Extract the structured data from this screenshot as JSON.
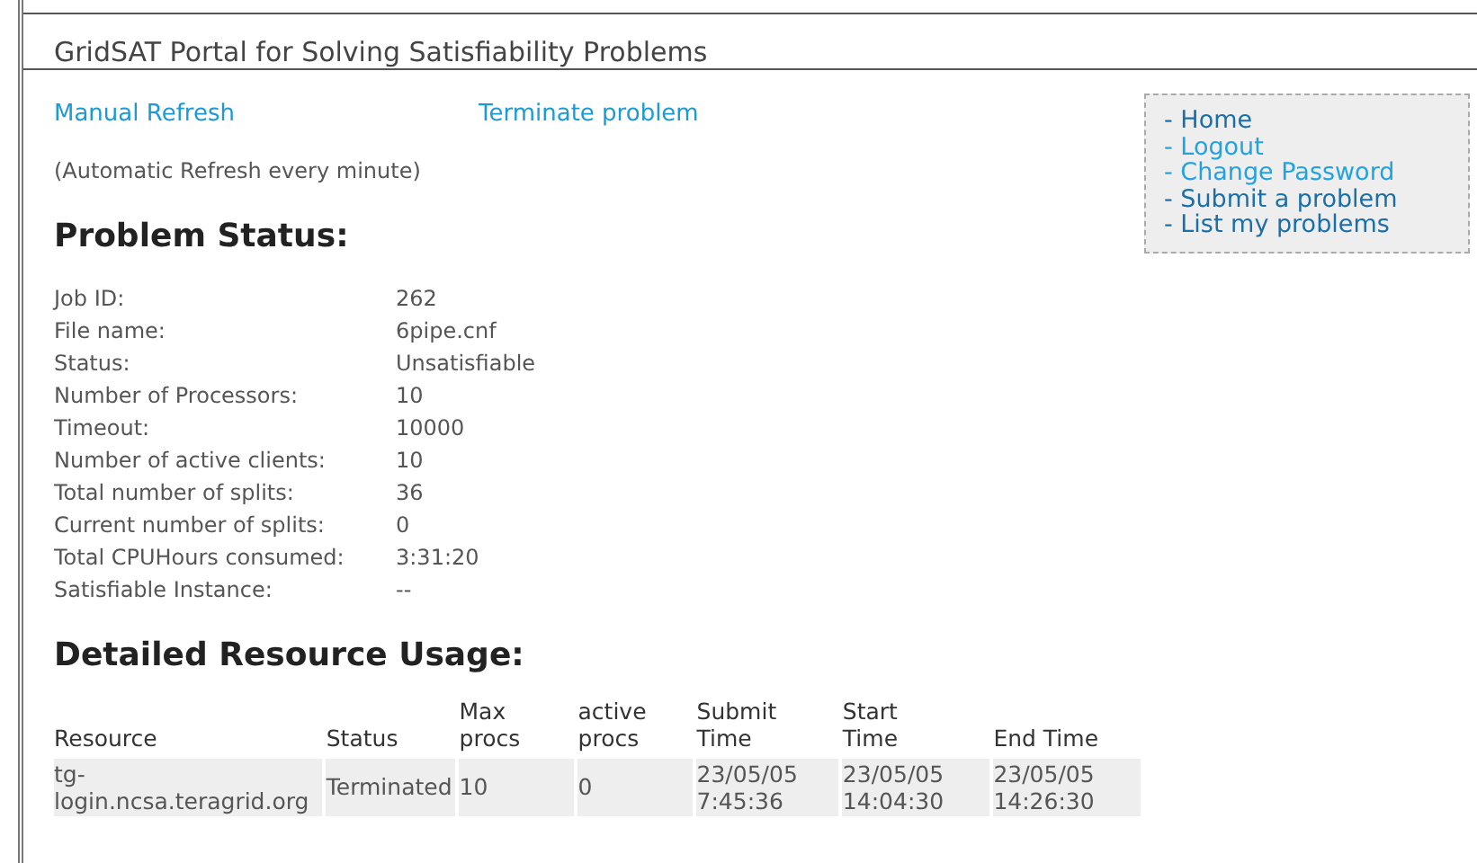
{
  "header": {
    "title": "GridSAT Portal for Solving Satisfiability Problems"
  },
  "actions": [
    {
      "label": "Manual Refresh"
    },
    {
      "label": "Terminate problem"
    }
  ],
  "note": "(Automatic Refresh every minute)",
  "menu": [
    {
      "label": "- Home",
      "visited": true
    },
    {
      "label": "- Logout",
      "visited": false
    },
    {
      "label": "- Change Password",
      "visited": false
    },
    {
      "label": "- Submit a problem",
      "visited": true
    },
    {
      "label": "- List my problems",
      "visited": true
    }
  ],
  "status_heading": "Problem Status:",
  "status": [
    {
      "label": "Job ID:",
      "value": "262"
    },
    {
      "label": "File name:",
      "value": "6pipe.cnf"
    },
    {
      "label": "Status:",
      "value": "Unsatisfiable"
    },
    {
      "label": "Number of Processors:",
      "value": "10"
    },
    {
      "label": "Timeout:",
      "value": "10000"
    },
    {
      "label": "Number of active clients:",
      "value": "10"
    },
    {
      "label": "Total number of splits:",
      "value": "36"
    },
    {
      "label": "Current number of splits:",
      "value": "0"
    },
    {
      "label": "Total CPUHours consumed:",
      "value": "3:31:20"
    },
    {
      "label": "Satisfiable Instance:",
      "value": "--"
    }
  ],
  "usage_heading": "Detailed Resource Usage:",
  "table": {
    "columns": [
      "Resource",
      "Status",
      "Max procs",
      "active procs",
      "Submit Time",
      "Start Time",
      "End Time"
    ],
    "rows": [
      [
        "tg-login.ncsa.teragrid.org",
        "Terminated",
        "10",
        "0",
        "23/05/05 7:45:36",
        "23/05/05 14:04:30",
        "23/05/05 14:26:30"
      ]
    ]
  }
}
